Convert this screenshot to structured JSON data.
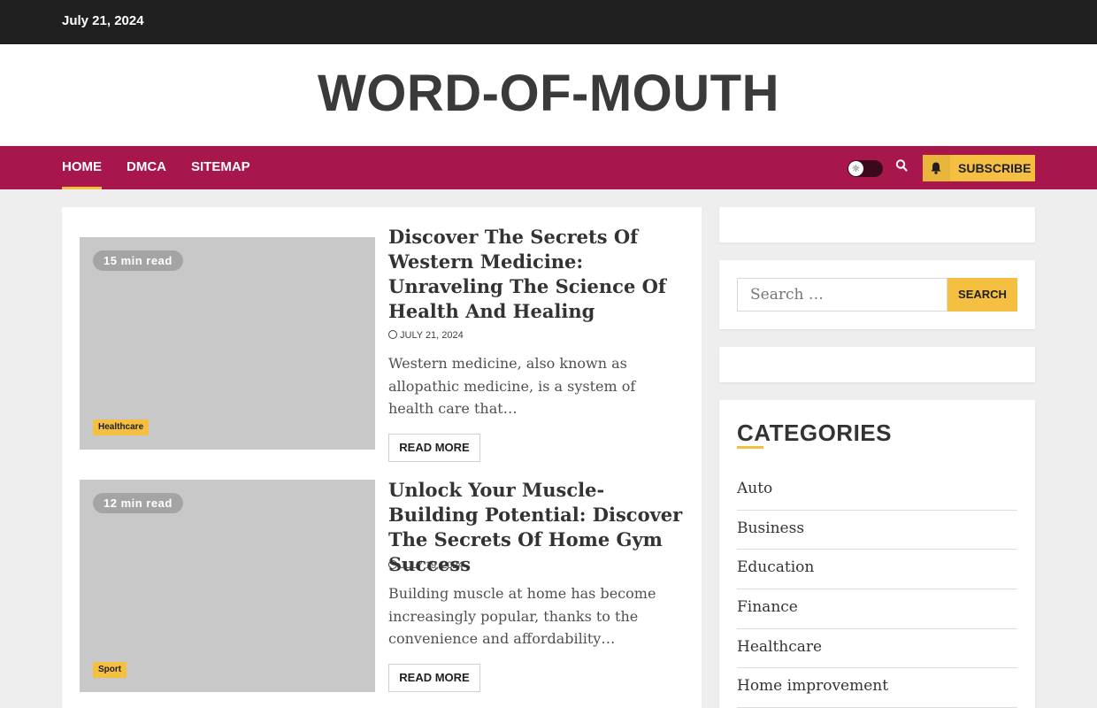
{
  "topbar": {
    "date": "July 21, 2024"
  },
  "site": {
    "title": "WORD-OF-MOUTH"
  },
  "nav": {
    "items": [
      {
        "label": "Home"
      },
      {
        "label": "DMCA"
      },
      {
        "label": "Sitemap"
      }
    ],
    "active_item": "Home",
    "subscribe_label": "Subscribe"
  },
  "posts": [
    {
      "read_time": "15 min read",
      "category": "Healthcare",
      "title": "Discover The Secrets Of Western Medicine: Unraveling The Science Of Health And Healing",
      "date": "July 21, 2024",
      "excerpt": "Western medicine, also known as allopathic medicine, is a system of health care that…",
      "read_more": "Read More"
    },
    {
      "read_time": "12 min read",
      "category": "Sport",
      "title": "Unlock Your Muscle-Building Potential: Discover The Secrets Of Home Gym Success",
      "date": "July 19, 2024",
      "excerpt": "Building muscle at home has become increasingly popular, thanks to the convenience and affordability…",
      "read_more": "Read More"
    }
  ],
  "sidebar": {
    "search": {
      "placeholder": "Search …",
      "button_label": "Search"
    },
    "categories": {
      "heading": "Categories",
      "items": [
        "Auto",
        "Business",
        "Education",
        "Finance",
        "Healthcare",
        "Home improvement"
      ]
    }
  },
  "colors": {
    "topbar": "#202020",
    "nav": "#a8174c",
    "accent": "#f5c041"
  },
  "icons": {
    "theme_toggle": "sun-icon",
    "search": "search-icon",
    "subscribe": "bell-icon",
    "date": "clock-icon"
  }
}
